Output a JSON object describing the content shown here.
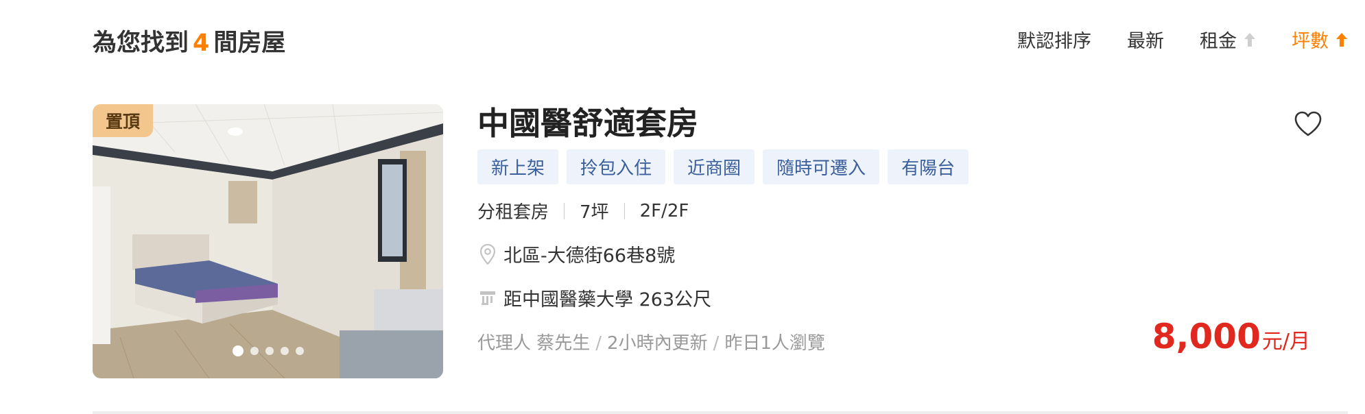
{
  "header": {
    "count_prefix": "為您找到",
    "count": "4",
    "count_suffix": "間房屋",
    "sort_options": [
      {
        "label": "默認排序",
        "arrow": "",
        "active": false
      },
      {
        "label": "最新",
        "arrow": "",
        "active": false
      },
      {
        "label": "租金",
        "arrow": "arrow-up-icon",
        "active": false
      },
      {
        "label": "坪數",
        "arrow": "arrow-up-icon",
        "active": true
      }
    ]
  },
  "listing": {
    "badge": "置頂",
    "photo_count": 5,
    "photo_active_index": 0,
    "title": "中國醫舒適套房",
    "tags": [
      "新上架",
      "拎包入住",
      "近商圈",
      "隨時可遷入",
      "有陽台"
    ],
    "specs": [
      "分租套房",
      "7坪",
      "2F/2F"
    ],
    "address": "北區-大德街66巷8號",
    "address_icon": "location-pin-icon",
    "nearby": "距中國醫藥大學 263公尺",
    "nearby_icon": "school-icon",
    "meta": {
      "agent": "代理人 蔡先生",
      "updated": "2小時內更新",
      "views": "昨日1人瀏覽"
    },
    "favorite_icon": "heart-outline-icon",
    "price": {
      "amount": "8,000",
      "unit": "元/月"
    }
  },
  "colors": {
    "accent": "#ff8000",
    "price": "#e0281f",
    "tag_bg": "#eef3fb",
    "tag_text": "#3a5f9c",
    "badge_bg": "#f2c68c"
  }
}
